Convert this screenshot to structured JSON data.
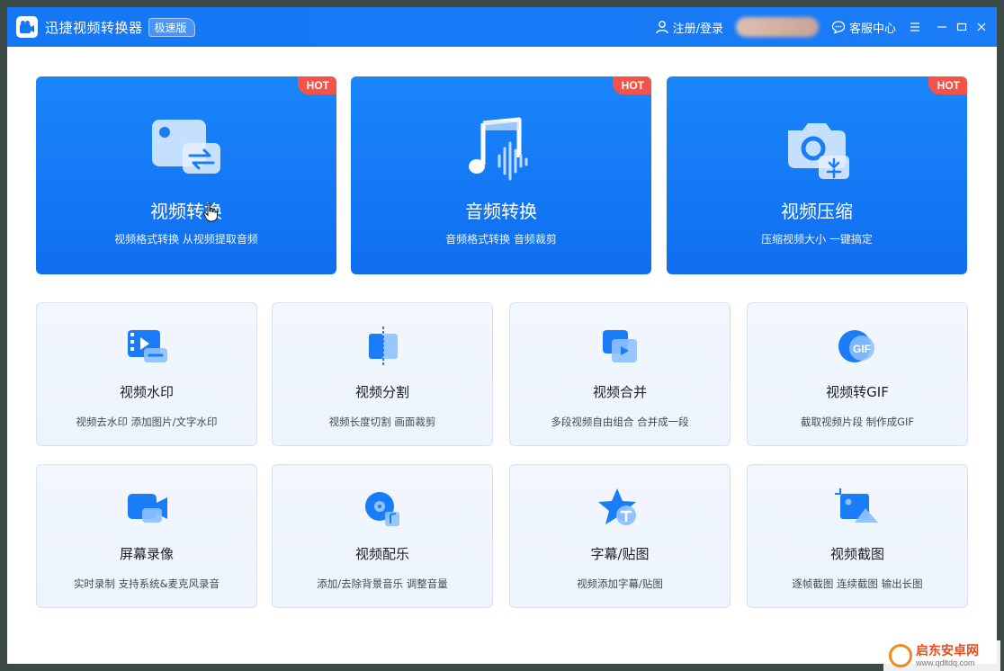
{
  "app": {
    "title": "迅捷视频转换器",
    "edition": "极速版"
  },
  "header": {
    "login": "注册/登录",
    "support": "客服中心"
  },
  "feature_cards": [
    {
      "title": "视频转换",
      "subtitle": "视频格式转换 从视频提取音频",
      "badge": "HOT"
    },
    {
      "title": "音频转换",
      "subtitle": "音频格式转换 音频裁剪",
      "badge": "HOT"
    },
    {
      "title": "视频压缩",
      "subtitle": "压缩视频大小 一键搞定",
      "badge": "HOT"
    }
  ],
  "tools": [
    {
      "title": "视频水印",
      "subtitle": "视频去水印 添加图片/文字水印"
    },
    {
      "title": "视频分割",
      "subtitle": "视频长度切割 画面裁剪"
    },
    {
      "title": "视频合并",
      "subtitle": "多段视频自由组合 合并成一段"
    },
    {
      "title": "视频转GIF",
      "subtitle": "截取视频片段 制作成GIF",
      "icon_label": "GIF"
    },
    {
      "title": "屏幕录像",
      "subtitle": "实时录制 支持系统&麦克风录音"
    },
    {
      "title": "视频配乐",
      "subtitle": "添加/去除背景音乐 调整音量"
    },
    {
      "title": "字幕/贴图",
      "subtitle": "视频添加字幕/贴图"
    },
    {
      "title": "视频截图",
      "subtitle": "逐帧截图 连续截图 输出长图"
    }
  ],
  "watermark": {
    "title": "启东安卓网",
    "url": "www.qdltdq.com"
  },
  "colors": {
    "titlebar": "#1677f5",
    "card_blue": "#1a86fb",
    "hot_badge": "#f5534a",
    "tool_bg": "#f2f7fe"
  }
}
